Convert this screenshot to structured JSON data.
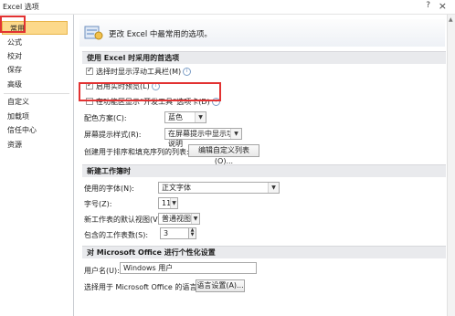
{
  "window": {
    "title": "Excel 选项",
    "help": "?",
    "close": "×"
  },
  "sidebar": {
    "items": [
      {
        "label": "常用"
      },
      {
        "label": "公式"
      },
      {
        "label": "校对"
      },
      {
        "label": "保存"
      },
      {
        "label": "高级"
      },
      {
        "label": "自定义"
      },
      {
        "label": "加载项"
      },
      {
        "label": "信任中心"
      },
      {
        "label": "资源"
      }
    ]
  },
  "header": {
    "text": "更改 Excel 中最常用的选项。"
  },
  "section1": {
    "title": "使用 Excel 时采用的首选项",
    "opt1": "选择时显示浮动工具栏(M)",
    "opt2": "启用实时预览(L)",
    "opt3": "在功能区显示“开发工具”选项卡(D)",
    "color_label": "配色方案(C):",
    "color_value": "蓝色",
    "tip_label": "屏幕提示样式(R):",
    "tip_value": "在屏幕提示中显示功能说明",
    "list_label": "创建用于排序和填充序列的列表:",
    "list_button": "编辑自定义列表(O)..."
  },
  "section2": {
    "title": "新建工作簿时",
    "font_label": "使用的字体(N):",
    "font_value": "正文字体",
    "size_label": "字号(Z):",
    "size_value": "11",
    "view_label": "新工作表的默认视图(V):",
    "view_value": "普通视图",
    "sheets_label": "包含的工作表数(S):",
    "sheets_value": "3"
  },
  "section3": {
    "title": "对 Microsoft Office 进行个性化设置",
    "user_label": "用户名(U):",
    "user_value": "Windows 用户",
    "lang_label": "选择用于 Microsoft Office 的语言:",
    "lang_button": "语言设置(A)..."
  }
}
